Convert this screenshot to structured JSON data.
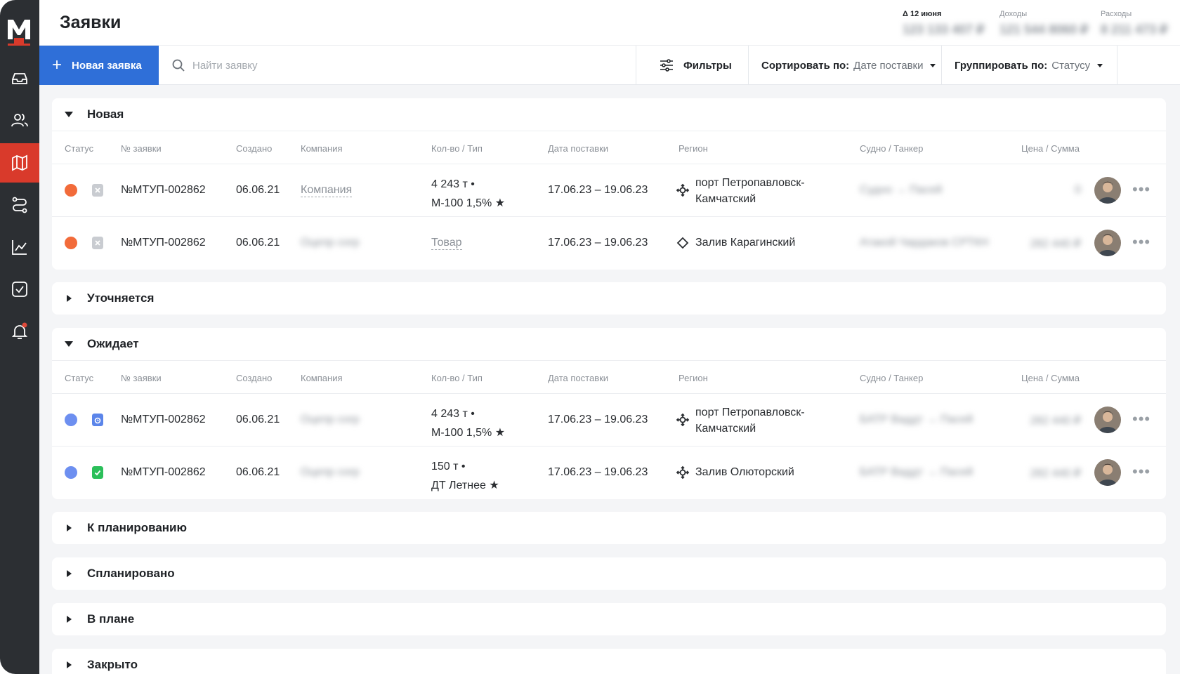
{
  "sidebar": {
    "logo": "М",
    "items": [
      {
        "icon": "inbox-icon"
      },
      {
        "icon": "users-icon"
      },
      {
        "icon": "map-icon",
        "active": true
      },
      {
        "icon": "route-icon"
      },
      {
        "icon": "chart-icon"
      },
      {
        "icon": "checkbox-icon"
      },
      {
        "icon": "bell-icon",
        "badge": true
      }
    ]
  },
  "header": {
    "title": "Заявки",
    "kpis": [
      {
        "label": "Δ 12 июня",
        "value": "123 133 407 ₽"
      },
      {
        "label": "Доходы",
        "value": "121 544 8060 ₽"
      },
      {
        "label": "Расходы",
        "value": "8 211 473 ₽"
      }
    ]
  },
  "toolbar": {
    "new_button": "Новая заявка",
    "search_placeholder": "Найти заявку",
    "filters": "Фильтры",
    "sort_label": "Сортировать по:",
    "sort_value": "Дате поставки",
    "group_label": "Группировать по:",
    "group_value": "Статусу"
  },
  "columns": [
    "Статус",
    "№ заявки",
    "Создано",
    "Компания",
    "Кол-во / Тип",
    "Дата поставки",
    "Регион",
    "Судно / Танкер",
    "Цена / Сумма"
  ],
  "groups": [
    {
      "title": "Новая",
      "expanded": true,
      "rows": [
        {
          "status_color": "#f26b3a",
          "doc": "gray",
          "number": "№МТУП-002862",
          "created": "06.06.21",
          "company": "Компания",
          "qty_line1": "4 243 т •",
          "qty_line2": "М-100 1,5% ★",
          "dates": "17.06.23 – 19.06.23",
          "region_icon": "crosshair-icon",
          "region_line1": "порт Петропавловск-",
          "region_line2": "Камчатский",
          "vessel": "Судно → Пасей",
          "price": "0"
        },
        {
          "status_color": "#f26b3a",
          "doc": "gray",
          "number": "№МТУП-002862",
          "created": "06.06.21",
          "company": "Оцепр сorp",
          "qty_line1": "Товар",
          "qty_line2": "",
          "dates": "17.06.23 – 19.06.23",
          "region_icon": "diamond-icon",
          "region_line1": "Залив Карагинский",
          "region_line2": "",
          "vessel": "Атакой Чардаков СРТКН",
          "price": "282 440 ₽"
        }
      ]
    },
    {
      "title": "Уточняется",
      "expanded": false
    },
    {
      "title": "Ожидает",
      "expanded": true,
      "rows": [
        {
          "status_color": "#6d8ff0",
          "doc": "blue",
          "number": "№МТУП-002862",
          "created": "06.06.21",
          "company": "Оцепр сorp",
          "qty_line1": "4 243 т •",
          "qty_line2": "М-100 1,5% ★",
          "dates": "17.06.23 – 19.06.23",
          "region_icon": "crosshair-icon",
          "region_line1": "порт Петропавловск-",
          "region_line2": "Камчатский",
          "vessel": "БАТР Ваддт → Пасей",
          "price": "282 440 ₽"
        },
        {
          "status_color": "#6d8ff0",
          "doc": "green",
          "number": "№МТУП-002862",
          "created": "06.06.21",
          "company": "Оцепр сorp",
          "qty_line1": "150 т •",
          "qty_line2": "ДТ Летнее ★",
          "dates": "17.06.23 – 19.06.23",
          "region_icon": "crosshair-icon",
          "region_line1": "Залив Олюторский",
          "region_line2": "",
          "vessel": "БАТР Ваддт → Пасей",
          "price": "282 440 ₽"
        }
      ]
    },
    {
      "title": "К планированию",
      "expanded": false
    },
    {
      "title": "Спланировано",
      "expanded": false
    },
    {
      "title": "В плане",
      "expanded": false
    },
    {
      "title": "Закрыто",
      "expanded": false
    }
  ]
}
